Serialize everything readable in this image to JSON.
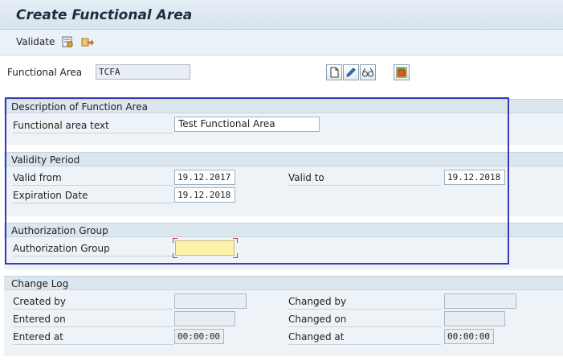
{
  "window": {
    "title": "Create Functional Area"
  },
  "toolbar": {
    "validate_label": "Validate"
  },
  "header": {
    "functional_area_label": "Functional Area",
    "functional_area_value": "TCFA"
  },
  "description_group": {
    "title": "Description of Function Area",
    "text_label": "Functional area text",
    "text_value": "Test Functional Area"
  },
  "validity_group": {
    "title": "Validity Period",
    "valid_from_label": "Valid from",
    "valid_from_value": "19.12.2017",
    "valid_to_label": "Valid to",
    "valid_to_value": "19.12.2018",
    "expiration_label": "Expiration Date",
    "expiration_value": "19.12.2018"
  },
  "auth_group": {
    "title": "Authorization Group",
    "field_label": "Authorization Group",
    "field_value": ""
  },
  "change_log": {
    "title": "Change Log",
    "created_by_label": "Created by",
    "created_by_value": "",
    "entered_on_label": "Entered on",
    "entered_on_value": "",
    "entered_at_label": "Entered at",
    "entered_at_value": "00:00:00",
    "changed_by_label": "Changed by",
    "changed_by_value": "",
    "changed_on_label": "Changed on",
    "changed_on_value": "",
    "changed_at_label": "Changed at",
    "changed_at_value": "00:00:00"
  },
  "colors": {
    "highlight": "#3a3ab8",
    "required_field": "#fdf2a9"
  },
  "icons": [
    "validate-icon",
    "export-icon",
    "new-document-icon",
    "edit-pencil-icon",
    "display-glasses-icon",
    "copy-icon"
  ]
}
